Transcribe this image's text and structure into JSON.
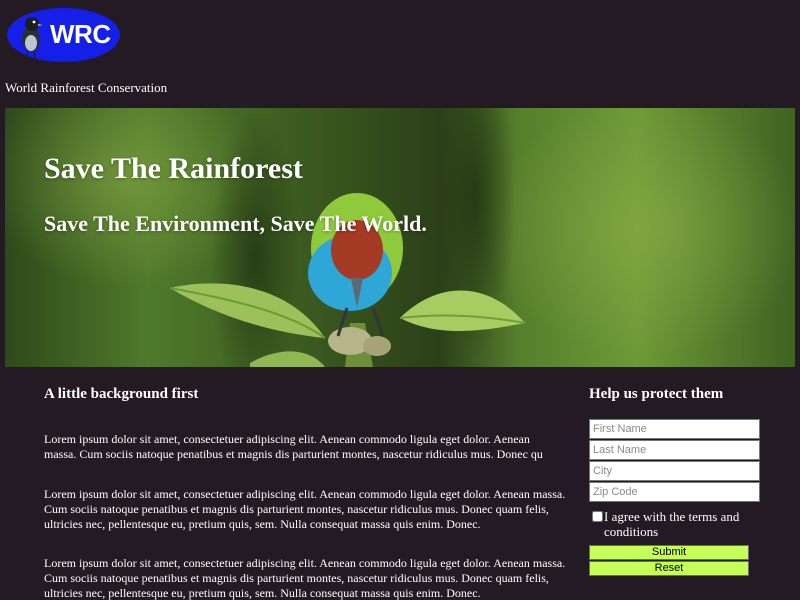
{
  "header": {
    "logo_text": "WRC",
    "org_name": "World Rainforest Conservation"
  },
  "hero": {
    "title": "Save The Rainforest",
    "subtitle": "Save The Environment, Save The World."
  },
  "background": {
    "heading": "A little background first",
    "paragraphs": [
      {
        "line1": "Lorem ipsum dolor sit amet, consectetuer adipiscing elit. Aenean commodo ligula eget dolor. Aenean",
        "line2": "massa. Cum sociis natoque penatibus et magnis dis parturient montes, nascetur ridiculus mus. Donec qu"
      },
      {
        "text": "Lorem ipsum dolor sit amet, consectetuer adipiscing elit. Aenean commodo ligula eget dolor. Aenean massa. Cum sociis natoque penatibus et magnis dis parturient montes, nascetur ridiculus mus. Donec quam felis, ultricies nec, pellentesque eu, pretium quis, sem. Nulla consequat massa quis enim. Donec."
      },
      {
        "text": "Lorem ipsum dolor sit amet, consectetuer adipiscing elit. Aenean commodo ligula eget dolor. Aenean massa. Cum sociis natoque penatibus et magnis dis parturient montes, nascetur ridiculus mus. Donec quam felis, ultricies nec, pellentesque eu, pretium quis, sem. Nulla consequat massa quis enim. Donec."
      }
    ]
  },
  "form": {
    "heading": "Help us protect them",
    "fields": {
      "first_name": {
        "placeholder": "First Name",
        "value": ""
      },
      "last_name": {
        "placeholder": "Last Name",
        "value": ""
      },
      "city": {
        "placeholder": "City",
        "value": ""
      },
      "zip": {
        "placeholder": "Zip Code",
        "value": ""
      }
    },
    "agree_label": "I agree with the terms and conditions",
    "agree_checked": false,
    "submit_label": "Submit",
    "reset_label": "Reset"
  },
  "colors": {
    "page_background": "#231a24",
    "logo_background": "#1420e8",
    "button_background": "#c5ff5a"
  },
  "icons": {
    "logo_mascot": "bird-icon"
  }
}
